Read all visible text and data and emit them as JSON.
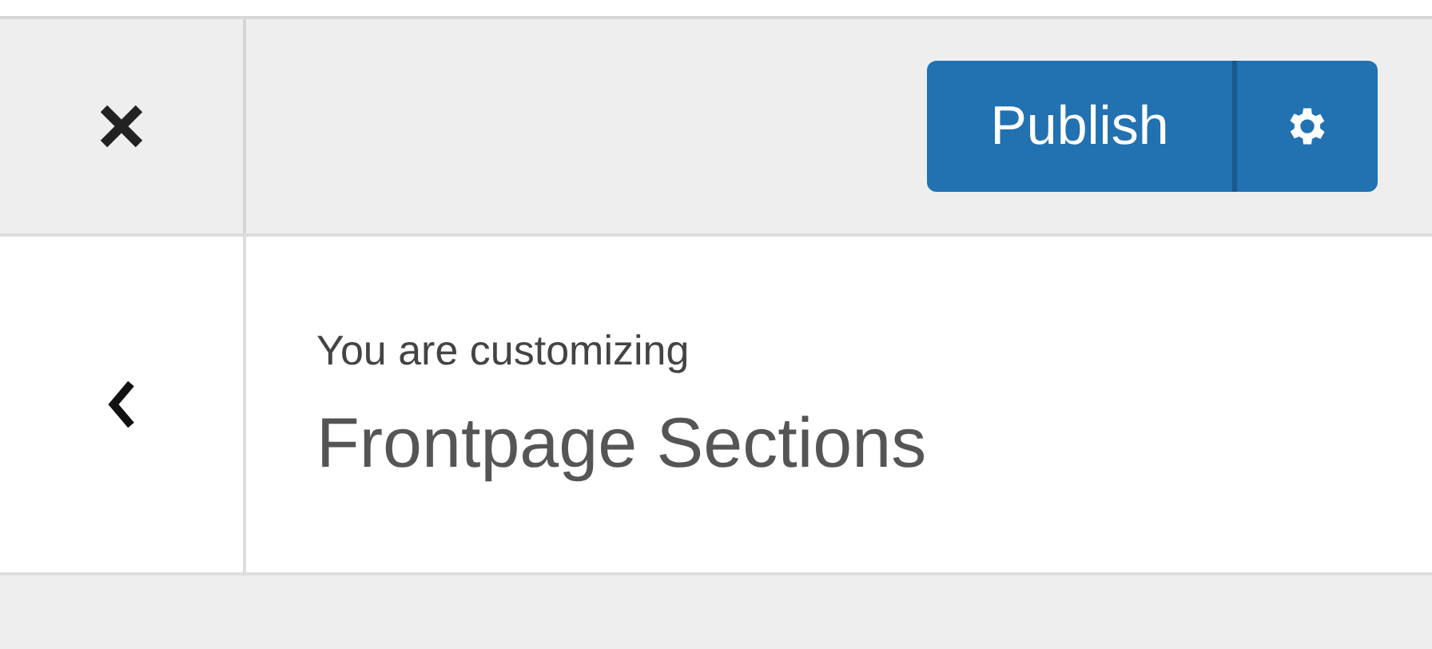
{
  "header": {
    "publish_button": "Publish"
  },
  "panel": {
    "subtitle": "You are customizing",
    "title": "Frontpage Sections"
  }
}
